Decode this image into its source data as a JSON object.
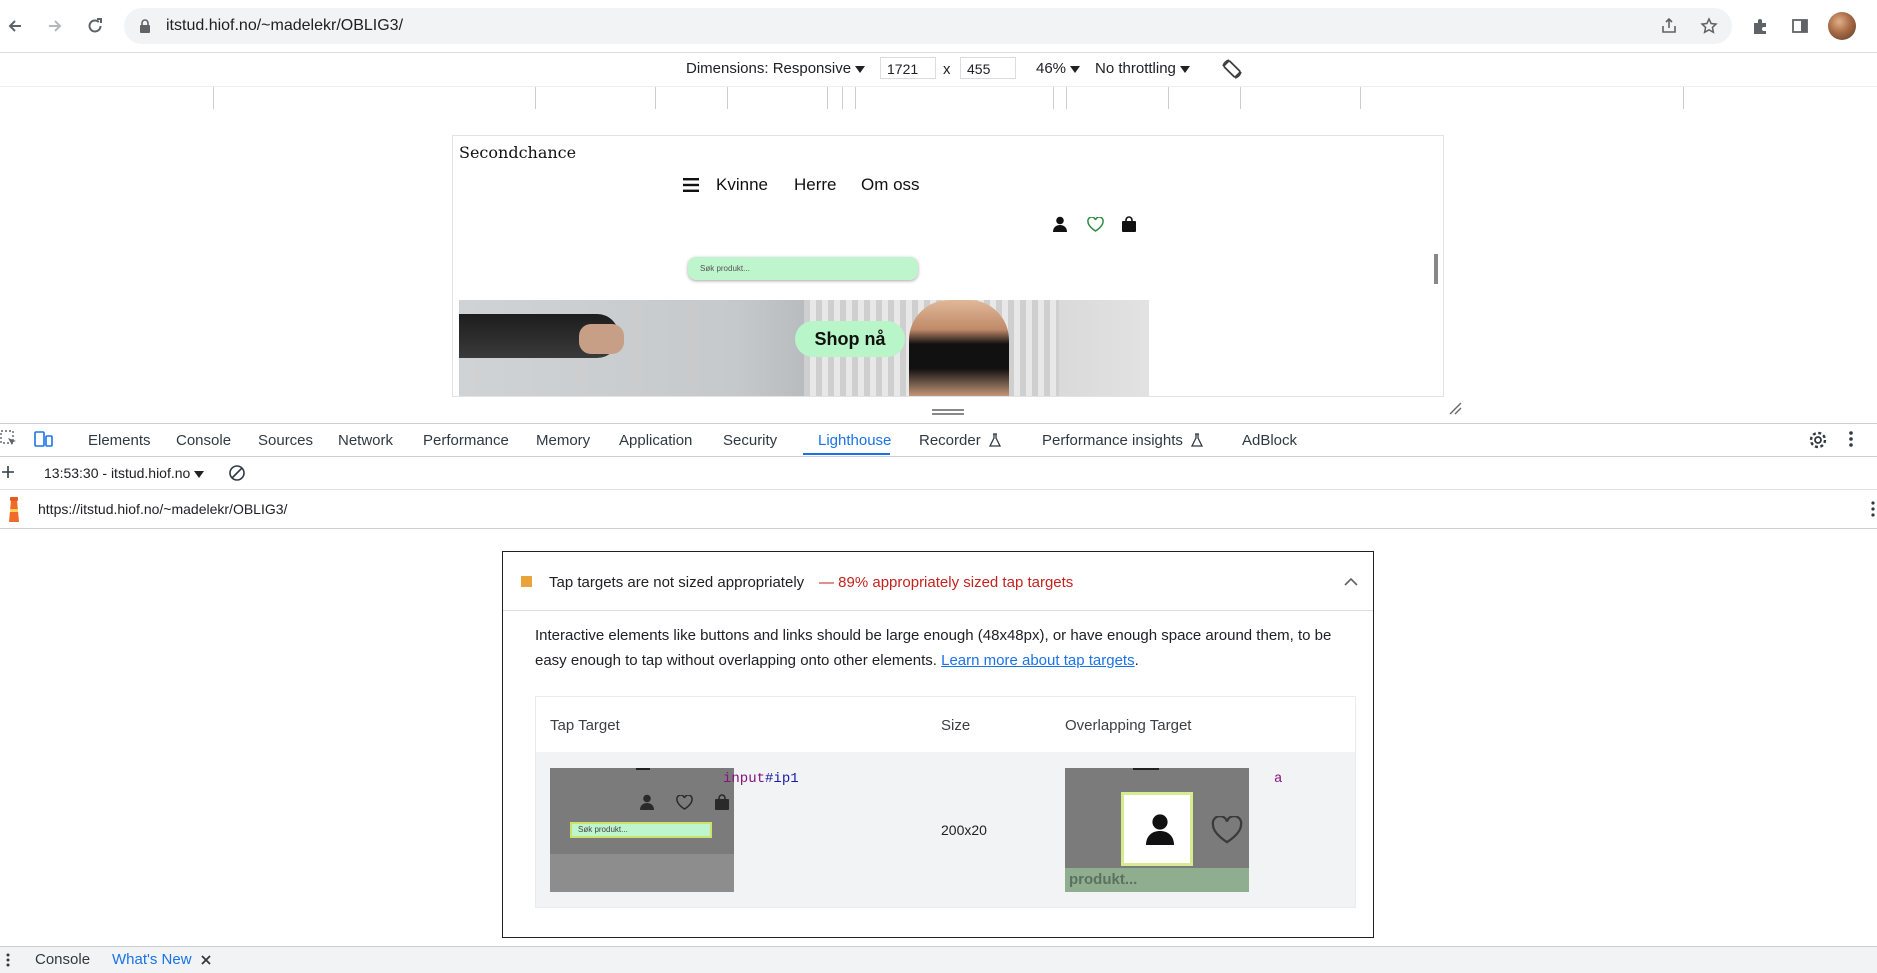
{
  "browser": {
    "url": "itstud.hiof.no/~madelekr/OBLIG3/",
    "icons": [
      "back-icon",
      "forward-icon",
      "reload-icon",
      "lock-icon",
      "share-icon",
      "star-icon",
      "extensions-icon",
      "side-panel-icon",
      "profile-avatar"
    ]
  },
  "device_toolbar": {
    "dimensions_label": "Dimensions: Responsive",
    "width": "1721",
    "times": "x",
    "height": "455",
    "zoom": "46%",
    "throttling": "No throttling"
  },
  "site": {
    "logo": "Secondchance",
    "nav": [
      "Kvinne",
      "Herre",
      "Om oss"
    ],
    "search_placeholder": "Søk produkt...",
    "hero_button": "Shop nå",
    "accent": "#bff5cc"
  },
  "devtools": {
    "tabs": [
      "Elements",
      "Console",
      "Sources",
      "Network",
      "Performance",
      "Memory",
      "Application",
      "Security",
      "Lighthouse",
      "Recorder",
      "Performance insights",
      "AdBlock"
    ],
    "active_tab": "Lighthouse",
    "accent": "#1a73e8",
    "report_select": "13:53:30 - itstud.hiof.no",
    "report_url": "https://itstud.hiof.no/~madelekr/OBLIG3/"
  },
  "audit": {
    "title": "Tap targets are not sized appropriately",
    "score": "— 89% appropriately sized tap targets",
    "score_color": "#c5221f",
    "description": "Interactive elements like buttons and links should be large enough (48x48px), or have enough space around them, to be easy enough to tap without overlapping onto other elements.",
    "learn_more": "Learn more about tap targets",
    "columns": [
      "Tap Target",
      "Size",
      "Overlapping Target"
    ],
    "row": {
      "target_tag": "input",
      "target_id": "#ip1",
      "thumb_search_text": "Søk produkt...",
      "size": "200x20",
      "overlap": "a",
      "overlap_thumb_text": "produkt..."
    }
  },
  "drawer": {
    "tabs": [
      "Console",
      "What's New"
    ]
  }
}
